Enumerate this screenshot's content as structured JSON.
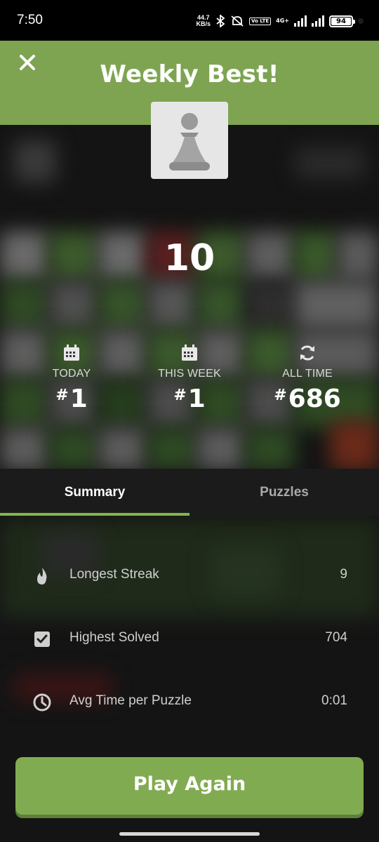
{
  "status_bar": {
    "time": "7:50",
    "net_speed_value": "44.7",
    "net_speed_unit": "KB/s",
    "volte_label": "Vo LTE",
    "network_label": "4G+",
    "battery_level": "94"
  },
  "header": {
    "title": "Weekly Best!",
    "close_icon": "close-icon",
    "piece_icon": "pawn-icon"
  },
  "score": "10",
  "rankings": [
    {
      "label": "TODAY",
      "hash": "#",
      "value": "1",
      "icon": "calendar-icon"
    },
    {
      "label": "THIS WEEK",
      "hash": "#",
      "value": "1",
      "icon": "calendar-icon"
    },
    {
      "label": "ALL TIME",
      "hash": "#",
      "value": "686",
      "icon": "refresh-icon"
    }
  ],
  "tabs": [
    {
      "label": "Summary",
      "active": true
    },
    {
      "label": "Puzzles",
      "active": false
    }
  ],
  "stats": [
    {
      "label": "Longest Streak",
      "value": "9",
      "icon": "flame-icon"
    },
    {
      "label": "Highest Solved",
      "value": "704",
      "icon": "checkbox-icon"
    },
    {
      "label": "Avg Time per Puzzle",
      "value": "0:01",
      "icon": "clock-icon"
    }
  ],
  "play_button": "Play Again",
  "colors": {
    "accent": "#81b64c",
    "banner": "#7ea452",
    "button": "#81ab50"
  }
}
